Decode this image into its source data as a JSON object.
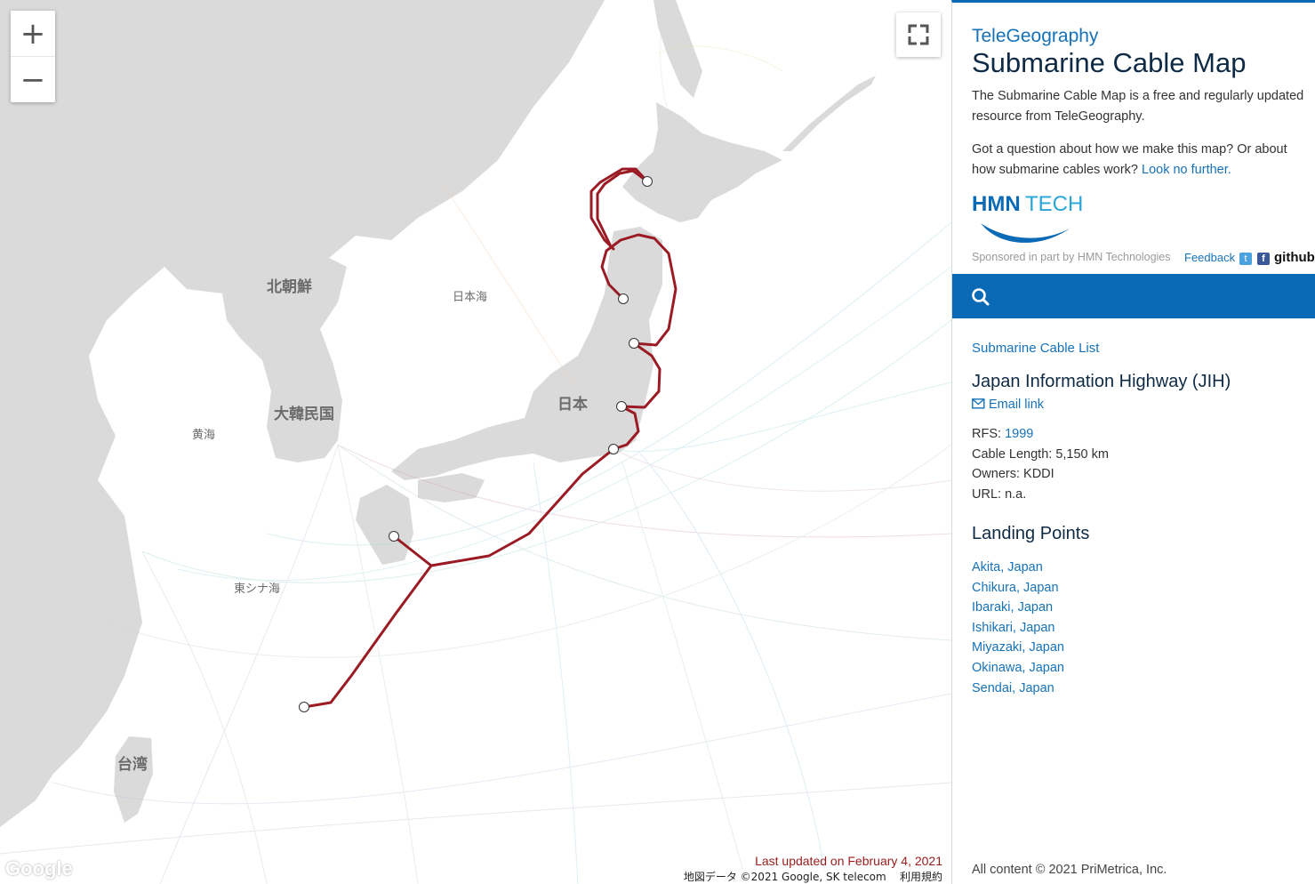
{
  "map": {
    "labels": {
      "north_korea": "北朝鮮",
      "south_korea": "大韓民国",
      "japan": "日本",
      "sea_of_japan": "日本海",
      "yellow_sea": "黄海",
      "east_china_sea": "東シナ海",
      "taiwan": "台湾"
    },
    "zoom_in": "+",
    "zoom_out": "−",
    "last_updated": "Last updated on February 4, 2021",
    "credits": "地図データ ©2021 Google, SK telecom",
    "terms": "利用規約",
    "google_logo": "Google",
    "cable_color": "#9b1b24"
  },
  "panel": {
    "brand": "TeleGeography",
    "title": "Submarine Cable Map",
    "intro": "The Submarine Cable Map is a free and regularly updated resource from TeleGeography.",
    "question": "Got a question about how we make this map? Or about how submarine cables work?",
    "question_link": "Look no further.",
    "sponsor_logo": "HMNTECH",
    "sponsor_text": "Sponsored in part by HMN Technologies",
    "feedback": "Feedback",
    "github": "github",
    "search_icon": "search-icon",
    "cable_list_link": "Submarine Cable List",
    "cable_name": "Japan Information Highway (JIH)",
    "email_link": "Email link",
    "rfs_label": "RFS:",
    "rfs_value": "1999",
    "length_label": "Cable Length:",
    "length_value": "5,150 km",
    "owners_label": "Owners:",
    "owners_value": "KDDI",
    "url_label": "URL:",
    "url_value": "n.a.",
    "landing_title": "Landing Points",
    "landing_points": [
      "Akita, Japan",
      "Chikura, Japan",
      "Ibaraki, Japan",
      "Ishikari, Japan",
      "Miyazaki, Japan",
      "Okinawa, Japan",
      "Sendai, Japan"
    ],
    "copyright": "All content © 2021 PriMetrica, Inc."
  }
}
